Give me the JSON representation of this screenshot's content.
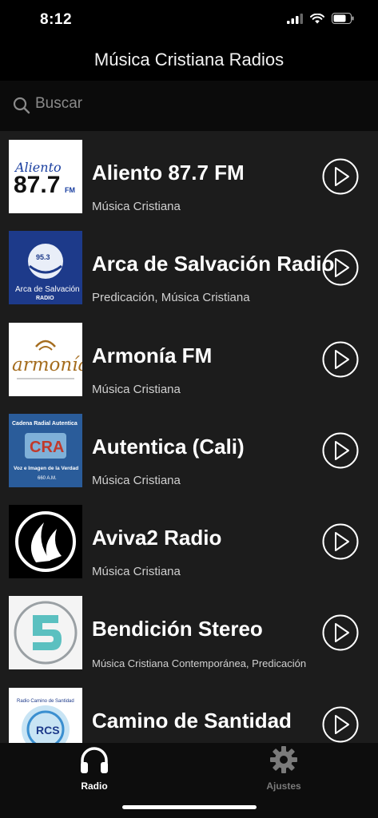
{
  "status_bar": {
    "time": "8:12"
  },
  "header": {
    "title": "Música Cristiana Radios"
  },
  "search": {
    "placeholder": "Buscar"
  },
  "stations": [
    {
      "name": "Aliento 87.7 FM",
      "genre": "Música Cristiana",
      "logo_text": "Aliento 87.7 FM"
    },
    {
      "name": "Arca de Salvación Radio",
      "genre": "Predicación, Música Cristiana",
      "logo_text": "95.3 FM Arca de Salvación RADIO"
    },
    {
      "name": "Armonía FM",
      "genre": "Música Cristiana",
      "logo_text": "armonía"
    },
    {
      "name": "Autentica (Cali)",
      "genre": "Música Cristiana",
      "logo_text": "Cadena Radial Autentica CRA Voz e Imagen de la Verdad 660 A.M."
    },
    {
      "name": "Aviva2 Radio",
      "genre": "Música Cristiana",
      "logo_text": ""
    },
    {
      "name": "Bendición Stereo",
      "genre": "Música Cristiana Contemporánea, Predicación",
      "logo_text": ""
    },
    {
      "name": "Camino de Santidad",
      "genre": "",
      "logo_text": "Radio Camino de Santidad RCS"
    }
  ],
  "tabs": [
    {
      "label": "Radio",
      "icon": "headphones-icon",
      "active": true
    },
    {
      "label": "Ajustes",
      "icon": "gear-icon",
      "active": false
    }
  ],
  "colors": {
    "background": "#000000",
    "list_background": "#1c1c1c",
    "accent": "#ffffff"
  }
}
